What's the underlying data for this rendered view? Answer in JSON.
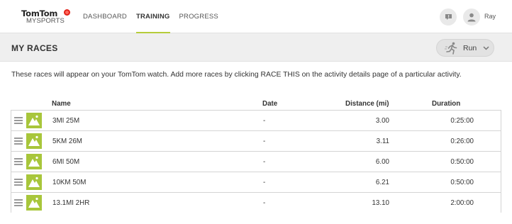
{
  "app": {
    "logo_top": "TomTom",
    "logo_bottom": "MYSPORTS",
    "brand_color": "#e2231a"
  },
  "nav": {
    "items": [
      {
        "label": "DASHBOARD",
        "active": false
      },
      {
        "label": "TRAINING",
        "active": true
      },
      {
        "label": "PROGRESS",
        "active": false
      }
    ],
    "accent_color": "#b5cc3a"
  },
  "user": {
    "name": "Ray",
    "feedback_icon": "speech-bubble-icon",
    "avatar_icon": "person-icon"
  },
  "page": {
    "title": "MY RACES",
    "sport_selector": {
      "selected": "Run",
      "icon": "runner-icon"
    },
    "intro": "These races will appear on your TomTom watch. Add more races by clicking RACE THIS on the activity details page of a particular activity."
  },
  "table": {
    "columns": [
      "Name",
      "Date",
      "Distance (mi)",
      "Duration"
    ],
    "rows": [
      {
        "name": "3MI 25M",
        "date": "-",
        "distance": "3.00",
        "duration": "0:25:00"
      },
      {
        "name": "5KM 26M",
        "date": "-",
        "distance": "3.11",
        "duration": "0:26:00"
      },
      {
        "name": "6MI 50M",
        "date": "-",
        "distance": "6.00",
        "duration": "0:50:00"
      },
      {
        "name": "10KM 50M",
        "date": "-",
        "distance": "6.21",
        "duration": "0:50:00"
      },
      {
        "name": "13.1MI 2HR",
        "date": "-",
        "distance": "13.10",
        "duration": "2:00:00"
      }
    ],
    "thumb_color": "#a8c63b",
    "thumb_icon": "mountain-icon",
    "handle_icon": "drag-handle-icon"
  }
}
